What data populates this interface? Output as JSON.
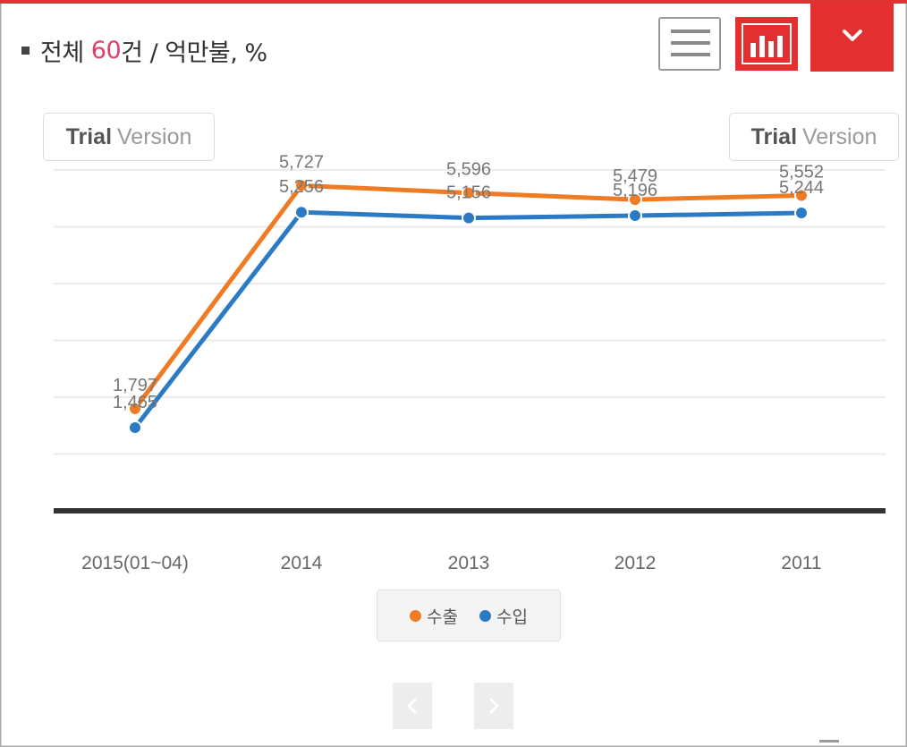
{
  "header": {
    "title_prefix": "전체",
    "title_count": "60",
    "title_suffix": "건 / 억만불, %"
  },
  "toolbar": {
    "list_view_icon": "hamburger-list-icon",
    "chart_view_icon": "bar-chart-icon",
    "dropdown_icon": "chevron-down-icon",
    "accent_color": "#e32f2f"
  },
  "watermark": {
    "bold": "Trial",
    "normal": "Version"
  },
  "chart_data": {
    "type": "line",
    "categories": [
      "2015(01~04)",
      "2014",
      "2013",
      "2012",
      "2011"
    ],
    "series": [
      {
        "name": "수출",
        "color": "#f07b25",
        "values": [
          1797,
          5727,
          5596,
          5479,
          5552
        ]
      },
      {
        "name": "수입",
        "color": "#2b7bc4",
        "values": [
          1465,
          5256,
          5156,
          5196,
          5244
        ]
      }
    ],
    "data_labels": [
      [
        "1,797",
        "5,727",
        "5,596",
        "5,479",
        "5,552"
      ],
      [
        "1,465",
        "5,256",
        "5,156",
        "5,196",
        "5,244"
      ]
    ],
    "ylim": [
      0,
      6000
    ],
    "grid": true,
    "legend": "bottom-center"
  },
  "pager": {
    "prev_icon": "chevron-left-icon",
    "next_icon": "chevron-right-icon"
  }
}
